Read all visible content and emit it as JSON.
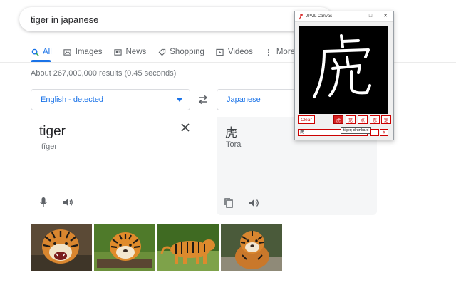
{
  "search": {
    "query": "tiger in japanese"
  },
  "tabs": [
    {
      "label": "All",
      "icon": "search-icon"
    },
    {
      "label": "Images",
      "icon": "image-icon"
    },
    {
      "label": "News",
      "icon": "news-icon"
    },
    {
      "label": "Shopping",
      "icon": "tag-icon"
    },
    {
      "label": "Videos",
      "icon": "play-icon"
    },
    {
      "label": "More",
      "icon": "more-vert-icon"
    }
  ],
  "results_stats": "About 267,000,000 results (0.45 seconds)",
  "translate": {
    "source_language": "English - detected",
    "target_language": "Japanese",
    "source_text": "tiger",
    "source_romanization": "tīger",
    "target_text": "虎",
    "target_romanization": "Tora"
  },
  "images": [
    {
      "name": "tiger-roaring"
    },
    {
      "name": "tiger-lying"
    },
    {
      "name": "tiger-walking"
    },
    {
      "name": "tiger-sitting"
    }
  ],
  "jpml_window": {
    "title": "JPML Canvas",
    "canvas_character": "虎",
    "clear_label": "Clear",
    "candidates": [
      "虎",
      "范",
      "点",
      "恋",
      "定"
    ],
    "input_value": "虎",
    "tooltip": "tiger; drunkard",
    "close_label": "X"
  },
  "colors": {
    "accent": "#1a73e8",
    "jpml_red": "#d61f1f",
    "muted_text": "#70757a"
  }
}
